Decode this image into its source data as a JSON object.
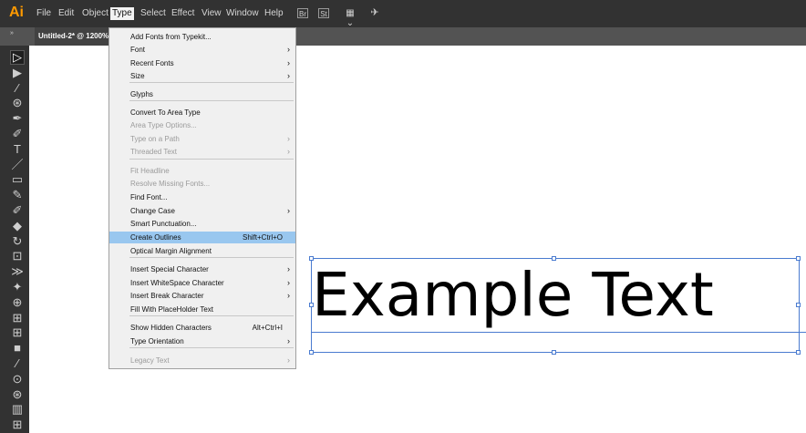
{
  "app": {
    "logo": "Ai"
  },
  "menubar": {
    "items": [
      "File",
      "Edit",
      "Object",
      "Type",
      "Select",
      "Effect",
      "View",
      "Window",
      "Help"
    ],
    "active_index": 3,
    "icons": [
      "bridge-icon",
      "stock-icon",
      "workspace-switcher-icon",
      "gpu-performance-icon"
    ],
    "icon_labels": {
      "bridge": "Br",
      "stock": "St"
    }
  },
  "document": {
    "tab_title": "Untitled-2* @ 1200%"
  },
  "canvas": {
    "text": "Example Text",
    "selection_color": "#4a7bd0"
  },
  "type_menu": {
    "highlight_color": "#99c7ef",
    "items": [
      {
        "label": "Add Fonts from Typekit...",
        "enabled": true
      },
      {
        "label": "Font",
        "enabled": true,
        "submenu": true
      },
      {
        "label": "Recent Fonts",
        "enabled": true,
        "submenu": true
      },
      {
        "label": "Size",
        "enabled": true,
        "submenu": true
      },
      {
        "label": "Glyphs",
        "enabled": true
      },
      {
        "label": "Convert To Area Type",
        "enabled": true
      },
      {
        "label": "Area Type Options...",
        "enabled": false
      },
      {
        "label": "Type on a Path",
        "enabled": false,
        "submenu": true
      },
      {
        "label": "Threaded Text",
        "enabled": false,
        "submenu": true
      },
      {
        "label": "Fit Headline",
        "enabled": false
      },
      {
        "label": "Resolve Missing Fonts...",
        "enabled": false
      },
      {
        "label": "Find Font...",
        "enabled": true
      },
      {
        "label": "Change Case",
        "enabled": true,
        "submenu": true
      },
      {
        "label": "Smart Punctuation...",
        "enabled": true
      },
      {
        "label": "Create Outlines",
        "enabled": true,
        "shortcut": "Shift+Ctrl+O",
        "highlighted": true
      },
      {
        "label": "Optical Margin Alignment",
        "enabled": true
      },
      {
        "label": "Insert Special Character",
        "enabled": true,
        "submenu": true
      },
      {
        "label": "Insert WhiteSpace Character",
        "enabled": true,
        "submenu": true
      },
      {
        "label": "Insert Break Character",
        "enabled": true,
        "submenu": true
      },
      {
        "label": "Fill With PlaceHolder Text",
        "enabled": true
      },
      {
        "label": "Show Hidden Characters",
        "enabled": true,
        "shortcut": "Alt+Ctrl+I"
      },
      {
        "label": "Type Orientation",
        "enabled": true,
        "submenu": true
      },
      {
        "label": "Legacy Text",
        "enabled": false,
        "submenu": true
      }
    ]
  },
  "tools": [
    "selection-tool-icon",
    "direct-selection-tool-icon",
    "magic-wand-tool-icon",
    "lasso-tool-icon",
    "pen-tool-icon",
    "curvature-tool-icon",
    "type-tool-icon",
    "line-segment-tool-icon",
    "rectangle-tool-icon",
    "paintbrush-tool-icon",
    "shaper-tool-icon",
    "eraser-tool-icon",
    "rotate-tool-icon",
    "scale-tool-icon",
    "width-tool-icon",
    "puppet-warp-tool-icon",
    "shape-builder-tool-icon",
    "perspective-grid-tool-icon",
    "mesh-tool-icon",
    "gradient-tool-icon",
    "eyedropper-tool-icon",
    "blend-tool-icon",
    "symbol-sprayer-tool-icon",
    "column-graph-tool-icon",
    "artboard-tool-icon"
  ]
}
